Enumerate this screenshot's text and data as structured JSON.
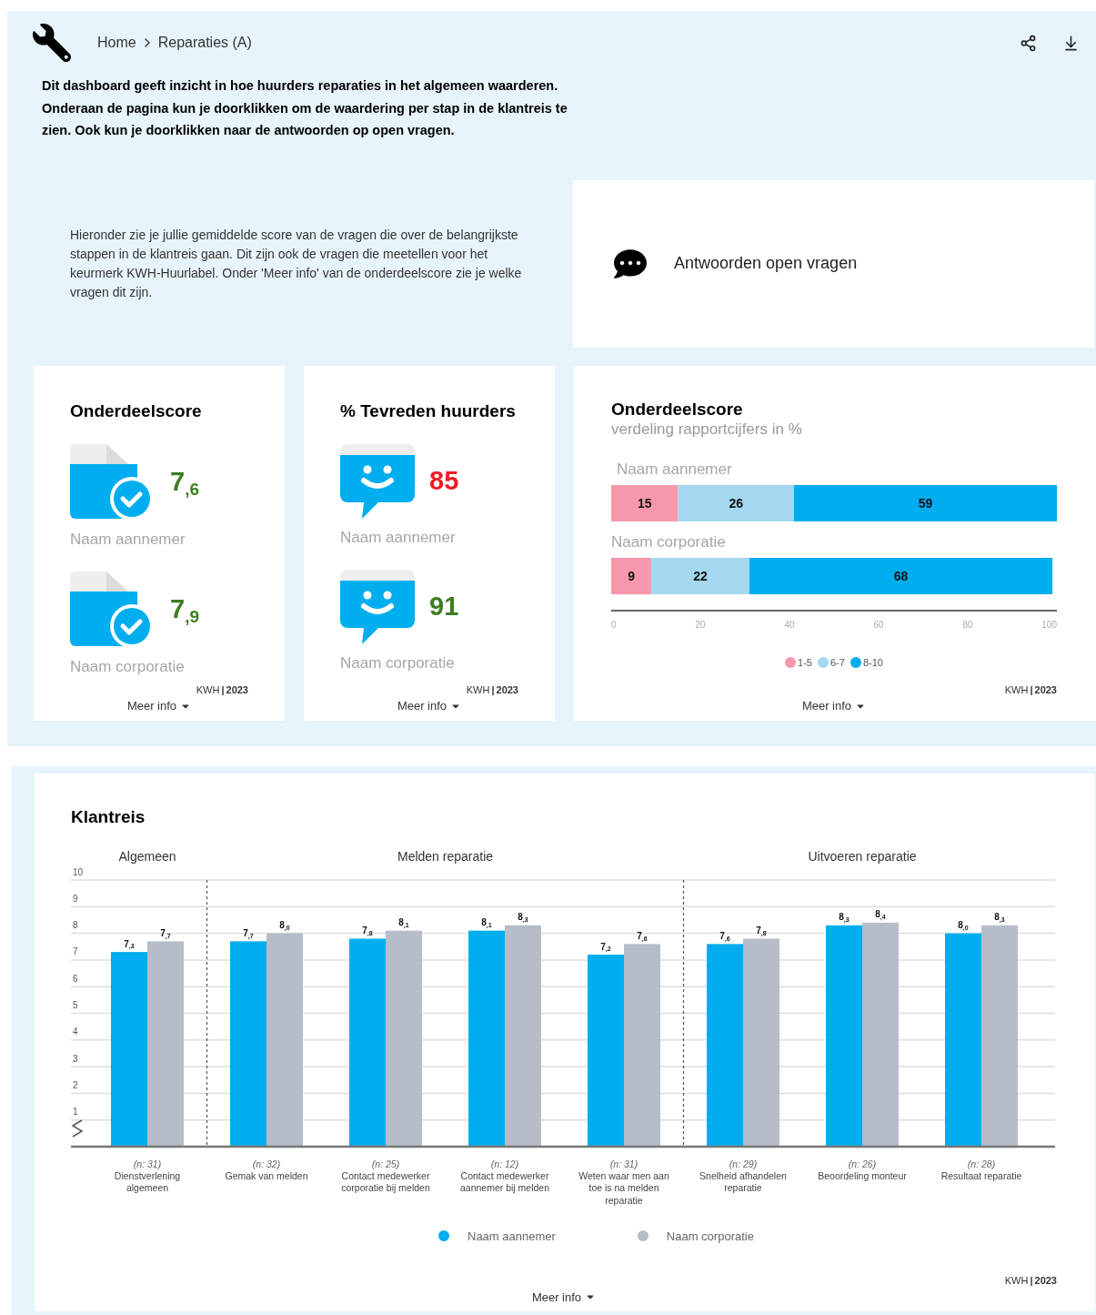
{
  "header": {
    "breadcrumb": [
      {
        "label": "Home"
      },
      {
        "label": "Reparaties (A)"
      }
    ]
  },
  "intro": "Dit dashboard geeft inzicht in hoe huurders reparaties in het algemeen waarderen. Onderaan de pagina kun je doorklikken om de waardering per stap in de klantreis te zien. Ook kun je doorklikken naar de antwoorden op open vragen.",
  "explanation": "Hieronder zie je jullie gemiddelde score van de vragen die over de belangrijkste stappen in de klantreis gaan. Dit zijn ook de vragen die meetellen voor het keurmerk KWH-Huurlabel. Onder 'Meer info' van de onderdeelscore zie je welke vragen dit zijn.",
  "open_questions": {
    "label": "Antwoorden open vragen"
  },
  "score_cards": [
    {
      "title": "Onderdeelscore",
      "kind": "document",
      "rows": [
        {
          "value": "7$_{,6}$",
          "color": "#3e7d22",
          "label": "Naam aannemer"
        },
        {
          "value": "7$_{,9}$",
          "color": "#3e7d22",
          "label": "Naam corporatie"
        }
      ],
      "source": "KWH",
      "separator": "|",
      "year": "2023",
      "more": "Meer info"
    },
    {
      "title": "% Tevreden huurders",
      "kind": "smiley",
      "rows": [
        {
          "value": "85",
          "color": "#ee1c25",
          "label": "Naam aannemer"
        },
        {
          "value": "91",
          "color": "#3e7d22",
          "label": "Naam corporatie"
        }
      ],
      "source": "KWH",
      "separator": "|",
      "year": "2023",
      "more": "Meer info"
    }
  ],
  "distribution_card": {
    "title": "Onderdeelscore",
    "subtitle": "verdeling rapportcijfers in %",
    "chart_data": {
      "type": "bar",
      "orientation": "horizontal",
      "stacked": true,
      "data_labels": true,
      "categories": [
        "Naam aannemer",
        "Naam corporatie"
      ],
      "xlim": [
        0,
        100
      ],
      "xticks": [
        0,
        20,
        40,
        60,
        80,
        100
      ],
      "series": [
        {
          "name": "1-5",
          "color": "#f797ab",
          "values": [
            15,
            9
          ]
        },
        {
          "name": "6-7",
          "color": "#a3d8ef",
          "values": [
            26,
            22
          ]
        },
        {
          "name": "8-10",
          "color": "#00aeef",
          "values": [
            59,
            68
          ]
        }
      ],
      "legend": "bottom"
    },
    "source": "KWH",
    "separator": "|",
    "year": "2023",
    "more": "Meer info"
  },
  "klantreis": {
    "title": "Klantreis",
    "groups": [
      {
        "title": "Algemeen",
        "items": [
          {
            "n": "(n: 31)"
          }
        ]
      },
      {
        "title": "Melden reparatie",
        "items": [
          {
            "n": "(n: 32)"
          },
          {
            "n": "(n: 25)"
          },
          {
            "n": "(n: 12)"
          },
          {
            "n": "(n: 31)"
          }
        ]
      },
      {
        "title": "Uitvoeren reparatie",
        "items": [
          {
            "n": "(n: 29)"
          },
          {
            "n": "(n: 26)"
          },
          {
            "n": "(n: 28)"
          }
        ]
      }
    ],
    "chart_data": {
      "type": "bar",
      "grid": true,
      "legend": "bottom",
      "ylim": [
        0,
        10
      ],
      "yticks": [
        1,
        2,
        3,
        4,
        5,
        6,
        7,
        8,
        9,
        10
      ],
      "categories": [
        "Dienstverlening algemeen",
        "Gemak van melden",
        "Contact medewerker corporatie bij melden",
        "Contact medewerker aannemer bij melden",
        "Weten waar men aan toe is na melden reparatie",
        "Snelheid afhandelen reparatie",
        "Beoordeling monteur",
        "Resultaat reparatie"
      ],
      "series": [
        {
          "name": "Naam aannemer",
          "color": "#00aeef",
          "values": [
            7.3,
            7.7,
            7.8,
            8.1,
            7.2,
            7.6,
            8.3,
            8.0
          ]
        },
        {
          "name": "Naam corporatie",
          "color": "#b6bcc8",
          "values": [
            7.7,
            8.0,
            8.1,
            8.3,
            7.6,
            7.8,
            8.4,
            8.3
          ]
        }
      ],
      "value_labels": [
        [
          "7$_{,3}$",
          "7$_{,7}$",
          "7$_{,8}$",
          "8$_{,1}$",
          "7$_{,2}$",
          "7$_{,6}$",
          "8$_{,3}$",
          "8$_{,0}$"
        ],
        [
          "7$_{,7}$",
          "8$_{,0}$",
          "8$_{,1}$",
          "8$_{,3}$",
          "7$_{,6}$",
          "7$_{,8}$",
          "8$_{,4}$",
          "8$_{,3}$"
        ]
      ]
    },
    "source": "KWH",
    "separator": "|",
    "year": "2023",
    "more": "Meer info"
  }
}
